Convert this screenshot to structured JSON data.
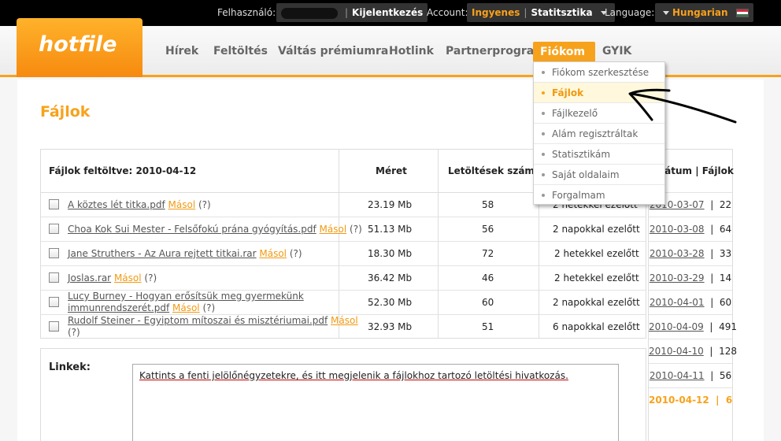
{
  "topbar": {
    "user_label": "Felhasználó:",
    "logout": "Kijelentkezés",
    "account_label": "Account:",
    "account_type": "Ingyenes",
    "stats": "Statitsztika",
    "language_label": "Language:",
    "language": "Hungarian"
  },
  "logo": "hotfile",
  "nav": {
    "items": [
      "Hírek",
      "Feltöltés",
      "Váltás prémiumra",
      "Hotlink",
      "Partnerprogram"
    ],
    "active": "Fiókom",
    "last": "GYIK"
  },
  "dropdown": {
    "items": [
      "Fiókom szerkesztése",
      "Fájlok",
      "Fájlkezelő",
      "Alám regisztráltak",
      "Statisztikám",
      "Saját oldalaim",
      "Forgalmam"
    ],
    "active_index": 1
  },
  "page_title": "Fájlok",
  "table": {
    "col_headers": [
      "Fájlok feltöltve: 2010-04-12",
      "Méret",
      "Letöltések száma"
    ],
    "copy_label": "Másol",
    "help_label": "(?)",
    "rows": [
      {
        "name": "A köztes lét titka.pdf",
        "size": "23.19 Mb",
        "downloads": "58",
        "ago": "2 hetekkel ezelőtt"
      },
      {
        "name": "Choa Kok Sui Mester - Felsőfokú prána gyógyítás.pdf",
        "size": "51.13 Mb",
        "downloads": "56",
        "ago": "2 napokkal ezelőtt"
      },
      {
        "name": "Jane Struthers - Az Aura rejtett titkai.rar",
        "size": "18.30 Mb",
        "downloads": "72",
        "ago": "2 hetekkel ezelőtt"
      },
      {
        "name": "Joslas.rar",
        "size": "36.42 Mb",
        "downloads": "46",
        "ago": "2 hetekkel ezelőtt"
      },
      {
        "name_l1": "Lucy Burney - Hogyan erősítsük meg gyermekünk",
        "name_l2": "immunrendszerét.pdf",
        "size": "52.30 Mb",
        "downloads": "60",
        "ago": "2 napokkal ezelőtt"
      },
      {
        "name": "Rudolf Steiner - Egyiptom mítoszai és misztériumai.pdf",
        "size": "32.93 Mb",
        "downloads": "51",
        "ago": "6 napokkal ezelőtt"
      }
    ]
  },
  "dates": {
    "header": "Dátum | Fájlok",
    "rows": [
      {
        "date": "2010-03-07",
        "count": "22"
      },
      {
        "date": "2010-03-08",
        "count": "64"
      },
      {
        "date": "2010-03-28",
        "count": "33"
      },
      {
        "date": "2010-03-29",
        "count": "14"
      },
      {
        "date": "2010-04-01",
        "count": "60"
      },
      {
        "date": "2010-04-09",
        "count": "491"
      },
      {
        "date": "2010-04-10",
        "count": "128"
      },
      {
        "date": "2010-04-11",
        "count": "56"
      },
      {
        "date": "2010-04-12",
        "count": "6"
      }
    ]
  },
  "links": {
    "label": "Linkek:",
    "placeholder": "Kattints a fenti jelölőnégyzetekre, és itt megjelenik a fájlokhoz tartozó letöltési hivatkozás."
  },
  "colors": {
    "accent": "#f7a21c",
    "topbar": "#000000"
  }
}
